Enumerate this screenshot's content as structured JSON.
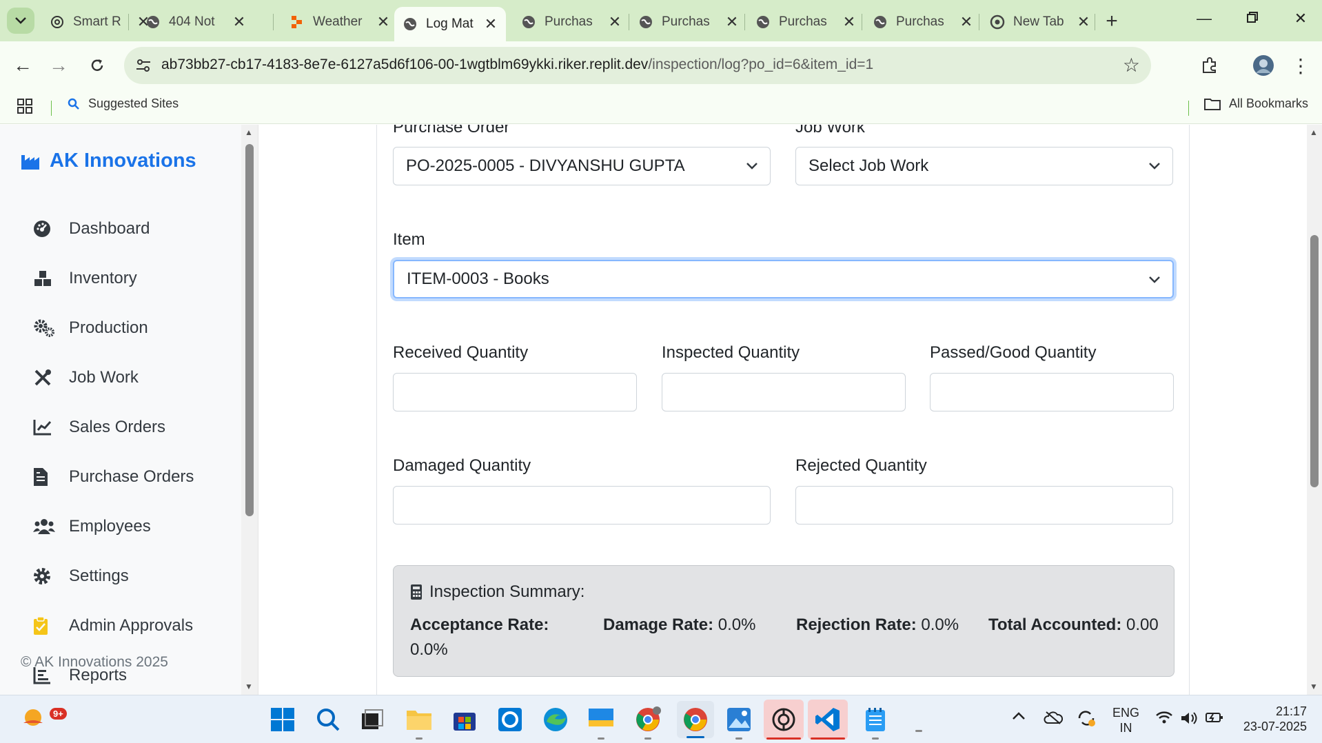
{
  "browser": {
    "tabs": [
      {
        "title": "Smart R",
        "icon": "openai-icon"
      },
      {
        "title": "404 Not",
        "icon": "globe-icon"
      },
      {
        "title": "Weather",
        "icon": "replit-icon"
      },
      {
        "title": "Log Mat",
        "icon": "globe-icon",
        "active": true
      },
      {
        "title": "Purchas",
        "icon": "globe-icon"
      },
      {
        "title": "Purchas",
        "icon": "globe-icon"
      },
      {
        "title": "Purchas",
        "icon": "globe-icon"
      },
      {
        "title": "Purchas",
        "icon": "globe-icon"
      },
      {
        "title": "New Tab",
        "icon": "chrome-icon"
      }
    ],
    "url_host": "ab73bb27-cb17-4183-8e7e-6127a5d6f106-00-1wgtblm69ykki.riker.replit.dev",
    "url_path": "/inspection/log?po_id=6&item_id=1",
    "bookmarks": {
      "suggested": "Suggested Sites",
      "all": "All Bookmarks"
    }
  },
  "sidebar": {
    "brand": "AK Innovations",
    "items": [
      {
        "label": "Dashboard",
        "icon": "dashboard-icon"
      },
      {
        "label": "Inventory",
        "icon": "boxes-icon"
      },
      {
        "label": "Production",
        "icon": "cogs-icon"
      },
      {
        "label": "Job Work",
        "icon": "tools-icon"
      },
      {
        "label": "Sales Orders",
        "icon": "chart-line-icon"
      },
      {
        "label": "Purchase Orders",
        "icon": "file-invoice-icon"
      },
      {
        "label": "Employees",
        "icon": "users-icon"
      },
      {
        "label": "Settings",
        "icon": "gear-icon"
      },
      {
        "label": "Admin Approvals",
        "icon": "clipboard-check-icon"
      },
      {
        "label": "Reports",
        "icon": "chart-bar-icon"
      }
    ],
    "copyright": "© AK Innovations 2025"
  },
  "form": {
    "purchase_order_label": "Purchase Order",
    "purchase_order_value": "PO-2025-0005 - DIVYANSHU GUPTA",
    "job_work_label": "Job Work",
    "job_work_value": "Select Job Work",
    "item_label": "Item",
    "item_value": "ITEM-0003 - Books",
    "received_label": "Received Quantity",
    "inspected_label": "Inspected Quantity",
    "passed_label": "Passed/Good Quantity",
    "damaged_label": "Damaged Quantity",
    "rejected_label": "Rejected Quantity"
  },
  "summary": {
    "title": "Inspection Summary:",
    "acceptance_label": "Acceptance Rate:",
    "acceptance_value": "0.0%",
    "damage_label": "Damage Rate:",
    "damage_value": "0.0%",
    "rejection_label": "Rejection Rate:",
    "rejection_value": "0.0%",
    "total_label": "Total Accounted:",
    "total_value": "0.00"
  },
  "taskbar": {
    "notification_badge": "9+",
    "lang_line1": "ENG",
    "lang_line2": "IN",
    "time": "21:17",
    "date": "23-07-2025"
  }
}
